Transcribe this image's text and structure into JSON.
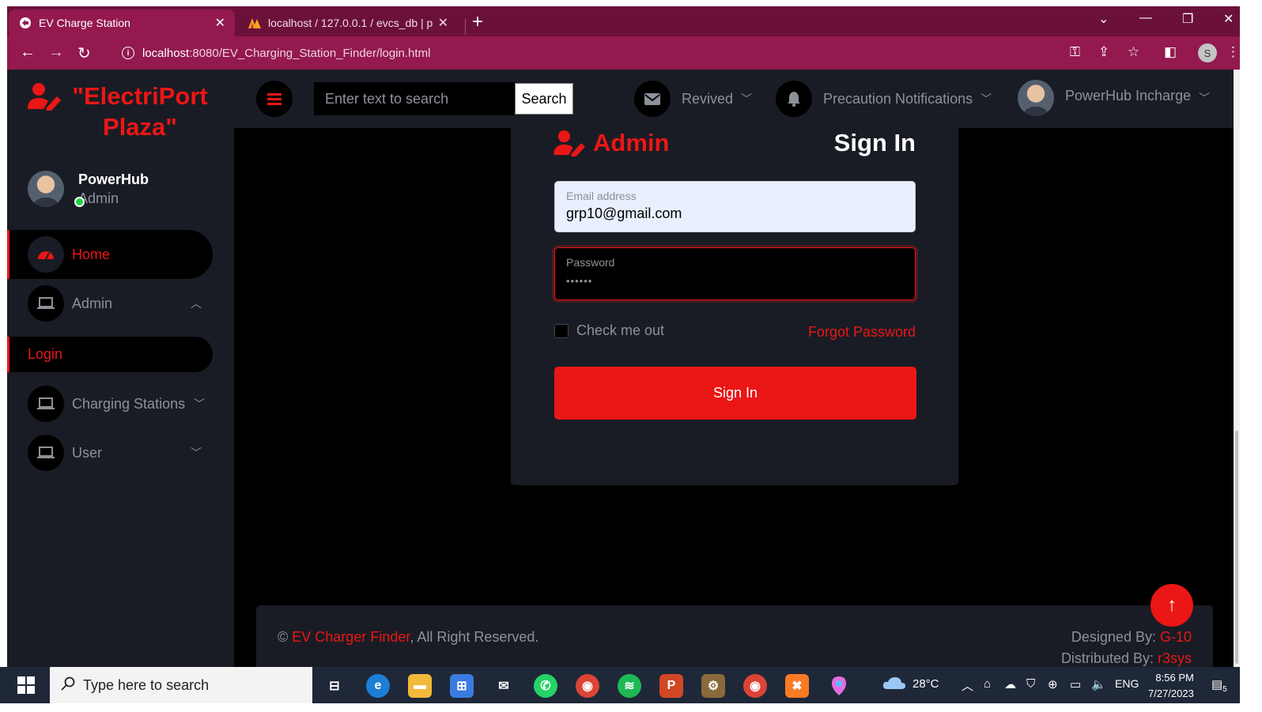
{
  "browser": {
    "tabs": [
      {
        "title": "EV Charge Station",
        "close": "✕"
      },
      {
        "title": "localhost / 127.0.0.1 / evcs_db | p",
        "close": "✕"
      }
    ],
    "new_tab": "+",
    "url_host": "localhost",
    "url_path": ":8080/EV_Charging_Station_Finder/login.html",
    "profile_initial": "S"
  },
  "sidebar": {
    "brand": "\"ElectriPort Plaza\"",
    "user_name": "PowerHub",
    "user_role": "Admin",
    "items": [
      {
        "label": "Home"
      },
      {
        "label": "Admin"
      },
      {
        "label": "Login"
      },
      {
        "label": "Charging Stations"
      },
      {
        "label": "User"
      }
    ]
  },
  "topbar": {
    "search_placeholder": "Enter text to search",
    "search_button": "Search",
    "messages_label": "Revived",
    "notifications_label": "Precaution Notifications",
    "profile_label": "PowerHub Incharge"
  },
  "login": {
    "heading_left": "Admin",
    "heading_right": "Sign In",
    "email_label": "Email address",
    "email_value": "grp10@gmail.com",
    "password_label": "Password",
    "password_value": "••••••",
    "remember_label": "Check me out",
    "forgot_label": "Forgot Password",
    "submit_label": "Sign In"
  },
  "footer": {
    "copyright_symbol": "©",
    "site_name": "EV Charger Finder",
    "rights": ", All Right Reserved.",
    "designed_prefix": "Designed By: ",
    "designed_by": "G-10",
    "distributed_prefix": "Distributed By: ",
    "distributed_by": "r3sys"
  },
  "taskbar": {
    "search_placeholder": "Type here to search",
    "weather": "28°C",
    "language": "ENG",
    "time": "8:56 PM",
    "date": "7/27/2023",
    "notification_count": "5"
  },
  "colors": {
    "accent": "#eb1616",
    "panel": "#191c24",
    "tab_bar": "#6b1139",
    "address_bar": "#93194e"
  }
}
